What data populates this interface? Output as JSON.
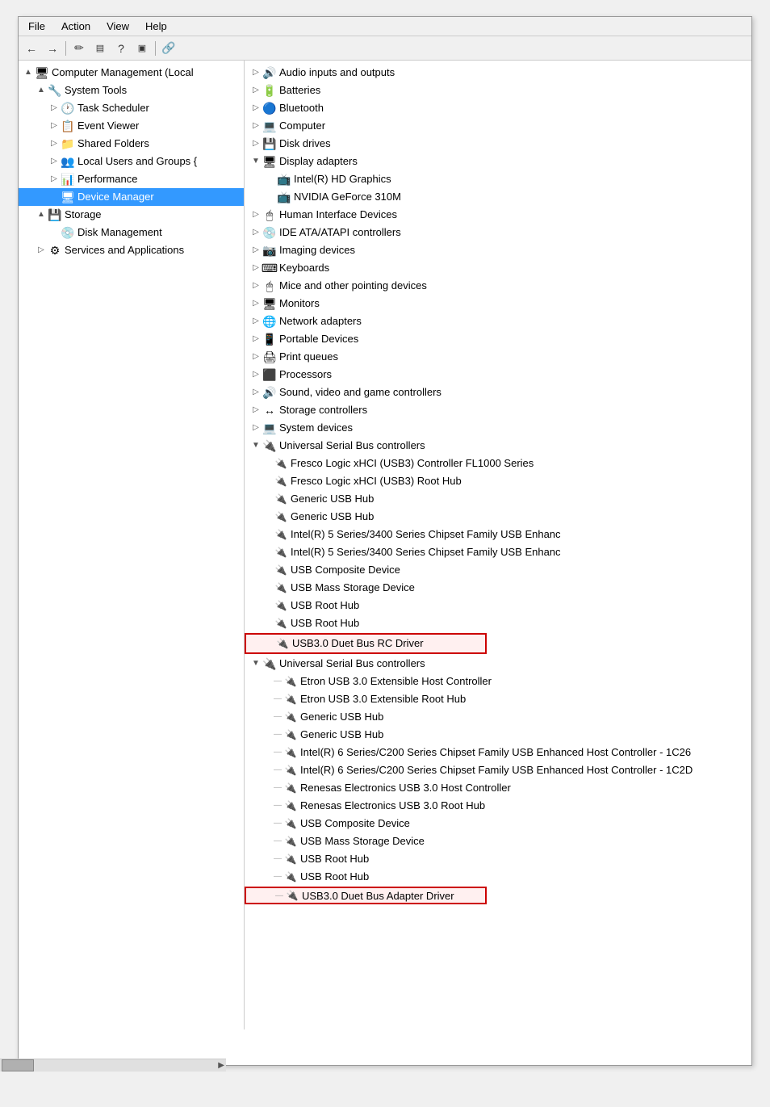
{
  "window": {
    "title": "Computer Management"
  },
  "menu": {
    "items": [
      "File",
      "Action",
      "View",
      "Help"
    ]
  },
  "toolbar": {
    "buttons": [
      "←",
      "→",
      "✏",
      "▤",
      "?",
      "▣",
      "🔗"
    ]
  },
  "left_tree": {
    "root": {
      "label": "Computer Management (Local",
      "icon": "🖥",
      "expanded": true
    },
    "items": [
      {
        "label": "System Tools",
        "icon": "🔧",
        "indent": 1,
        "expanded": true,
        "toggle": "▲"
      },
      {
        "label": "Task Scheduler",
        "icon": "🕐",
        "indent": 2,
        "toggle": "▷"
      },
      {
        "label": "Event Viewer",
        "icon": "📋",
        "indent": 2,
        "toggle": "▷"
      },
      {
        "label": "Shared Folders",
        "icon": "📁",
        "indent": 2,
        "toggle": "▷"
      },
      {
        "label": "Local Users and Groups {",
        "icon": "👥",
        "indent": 2,
        "toggle": "▷"
      },
      {
        "label": "Performance",
        "icon": "📊",
        "indent": 2,
        "toggle": "▷"
      },
      {
        "label": "Device Manager",
        "icon": "🖥",
        "indent": 2,
        "toggle": "",
        "selected": true
      },
      {
        "label": "Storage",
        "icon": "💾",
        "indent": 1,
        "expanded": true,
        "toggle": "▲"
      },
      {
        "label": "Disk Management",
        "icon": "💿",
        "indent": 2,
        "toggle": ""
      },
      {
        "label": "Services and Applications",
        "icon": "⚙",
        "indent": 1,
        "toggle": "▷"
      }
    ]
  },
  "right_tree": {
    "items": [
      {
        "label": "Audio inputs and outputs",
        "icon": "🔊",
        "indent": 0,
        "toggle": "▷"
      },
      {
        "label": "Batteries",
        "icon": "🔋",
        "indent": 0,
        "toggle": "▷"
      },
      {
        "label": "Bluetooth",
        "icon": "🔵",
        "indent": 0,
        "toggle": "▷"
      },
      {
        "label": "Computer",
        "icon": "💻",
        "indent": 0,
        "toggle": "▷"
      },
      {
        "label": "Disk drives",
        "icon": "💾",
        "indent": 0,
        "toggle": "▷"
      },
      {
        "label": "Display adapters",
        "icon": "🖥",
        "indent": 0,
        "toggle": "▼",
        "expanded": true
      },
      {
        "label": "Intel(R) HD Graphics",
        "icon": "📺",
        "indent": 1,
        "toggle": ""
      },
      {
        "label": "NVIDIA GeForce 310M",
        "icon": "📺",
        "indent": 1,
        "toggle": ""
      },
      {
        "label": "Human Interface Devices",
        "icon": "🖱",
        "indent": 0,
        "toggle": "▷"
      },
      {
        "label": "IDE ATA/ATAPI controllers",
        "icon": "💿",
        "indent": 0,
        "toggle": "▷"
      },
      {
        "label": "Imaging devices",
        "icon": "📷",
        "indent": 0,
        "toggle": "▷"
      },
      {
        "label": "Keyboards",
        "icon": "⌨",
        "indent": 0,
        "toggle": "▷"
      },
      {
        "label": "Mice and other pointing devices",
        "icon": "🖱",
        "indent": 0,
        "toggle": "▷"
      },
      {
        "label": "Monitors",
        "icon": "🖥",
        "indent": 0,
        "toggle": "▷"
      },
      {
        "label": "Network adapters",
        "icon": "🌐",
        "indent": 0,
        "toggle": "▷"
      },
      {
        "label": "Portable Devices",
        "icon": "📱",
        "indent": 0,
        "toggle": "▷"
      },
      {
        "label": "Print queues",
        "icon": "🖨",
        "indent": 0,
        "toggle": "▷"
      },
      {
        "label": "Processors",
        "icon": "⬛",
        "indent": 0,
        "toggle": "▷"
      },
      {
        "label": "Sound, video and game controllers",
        "icon": "🔊",
        "indent": 0,
        "toggle": "▷"
      },
      {
        "label": "Storage controllers",
        "icon": "💾",
        "indent": 0,
        "toggle": "▷"
      },
      {
        "label": "System devices",
        "icon": "💻",
        "indent": 0,
        "toggle": "▷"
      },
      {
        "label": "Universal Serial Bus controllers",
        "icon": "🔌",
        "indent": 0,
        "toggle": "▼",
        "expanded": true
      },
      {
        "label": "Fresco Logic xHCI (USB3) Controller FL1000 Series",
        "icon": "🔌",
        "indent": 1,
        "toggle": ""
      },
      {
        "label": "Fresco Logic xHCI (USB3) Root Hub",
        "icon": "🔌",
        "indent": 1,
        "toggle": ""
      },
      {
        "label": "Generic USB Hub",
        "icon": "🔌",
        "indent": 1,
        "toggle": ""
      },
      {
        "label": "Generic USB Hub",
        "icon": "🔌",
        "indent": 1,
        "toggle": ""
      },
      {
        "label": "Intel(R) 5 Series/3400 Series Chipset Family USB Enhanc",
        "icon": "🔌",
        "indent": 1,
        "toggle": ""
      },
      {
        "label": "Intel(R) 5 Series/3400 Series Chipset Family USB Enhanc",
        "icon": "🔌",
        "indent": 1,
        "toggle": ""
      },
      {
        "label": "USB Composite Device",
        "icon": "🔌",
        "indent": 1,
        "toggle": ""
      },
      {
        "label": "USB Mass Storage Device",
        "icon": "🔌",
        "indent": 1,
        "toggle": ""
      },
      {
        "label": "USB Root Hub",
        "icon": "🔌",
        "indent": 1,
        "toggle": ""
      },
      {
        "label": "USB Root Hub",
        "icon": "🔌",
        "indent": 1,
        "toggle": ""
      },
      {
        "label": "USB3.0 Duet Bus RC Driver",
        "icon": "🔌",
        "indent": 1,
        "toggle": "",
        "highlighted": true
      },
      {
        "label": "Universal Serial Bus controllers",
        "icon": "🔌",
        "indent": 0,
        "toggle": "▼",
        "expanded": true
      },
      {
        "label": "Etron USB 3.0 Extensible Host Controller",
        "icon": "🔌",
        "indent": 1,
        "toggle": "",
        "dash": true
      },
      {
        "label": "Etron USB 3.0 Extensible Root Hub",
        "icon": "🔌",
        "indent": 1,
        "toggle": "",
        "dash": true
      },
      {
        "label": "Generic USB Hub",
        "icon": "🔌",
        "indent": 1,
        "toggle": "",
        "dash": true
      },
      {
        "label": "Generic USB Hub",
        "icon": "🔌",
        "indent": 1,
        "toggle": "",
        "dash": true
      },
      {
        "label": "Intel(R) 6 Series/C200 Series Chipset Family USB Enhanced Host Controller - 1C26",
        "icon": "🔌",
        "indent": 1,
        "toggle": "",
        "dash": true
      },
      {
        "label": "Intel(R) 6 Series/C200 Series Chipset Family USB Enhanced Host Controller - 1C2D",
        "icon": "🔌",
        "indent": 1,
        "toggle": "",
        "dash": true
      },
      {
        "label": "Renesas Electronics USB 3.0 Host Controller",
        "icon": "🔌",
        "indent": 1,
        "toggle": "",
        "dash": true
      },
      {
        "label": "Renesas Electronics USB 3.0 Root Hub",
        "icon": "🔌",
        "indent": 1,
        "toggle": "",
        "dash": true
      },
      {
        "label": "USB Composite Device",
        "icon": "🔌",
        "indent": 1,
        "toggle": "",
        "dash": true
      },
      {
        "label": "USB Mass Storage Device",
        "icon": "🔌",
        "indent": 1,
        "toggle": "",
        "dash": true
      },
      {
        "label": "USB Root Hub",
        "icon": "🔌",
        "indent": 1,
        "toggle": "",
        "dash": true
      },
      {
        "label": "USB Root Hub",
        "icon": "🔌",
        "indent": 1,
        "toggle": "",
        "dash": true
      },
      {
        "label": "USB3.0 Duet Bus Adapter Driver",
        "icon": "🔌",
        "indent": 1,
        "toggle": "",
        "dash": true,
        "highlighted": true
      }
    ]
  }
}
